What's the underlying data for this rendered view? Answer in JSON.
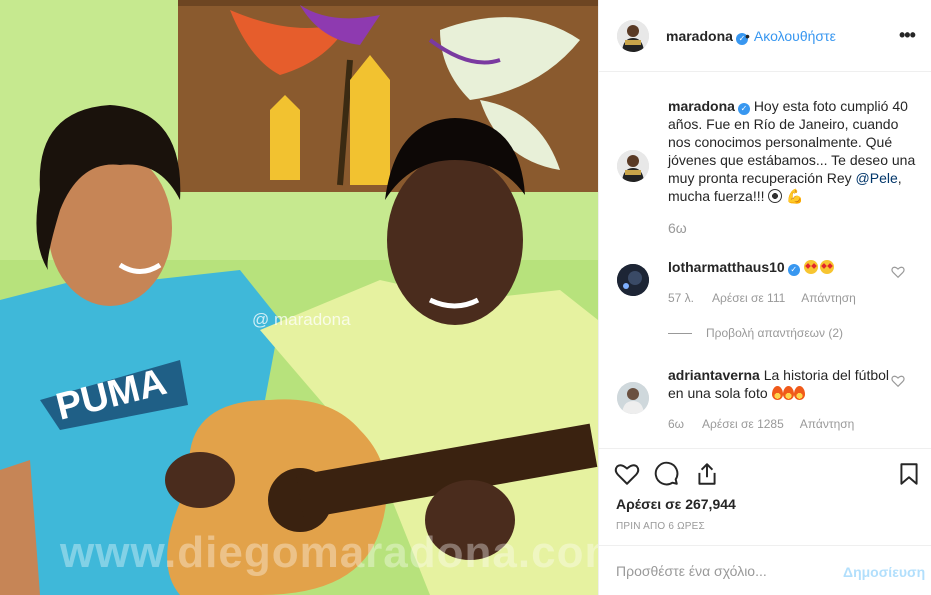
{
  "photo": {
    "watermark": "@ maradona",
    "bottom_watermark": "www.diegomaradona.com",
    "shirt_text": "PUMA"
  },
  "header": {
    "username": "maradona",
    "separator": "•",
    "follow_label": "Ακολουθήστε",
    "more_icon": "more-options-icon"
  },
  "caption": {
    "username": "maradona",
    "text_before_mention": "Hoy esta foto cumplió 40 años. Fue en Río de Janeiro, cuando nos conocimos personalmente. Qué jóvenes que estábamos... Te deseo una muy pronta recuperación Rey ",
    "mention": "@Pele",
    "text_after_mention": ", mucha fuerza!!! ",
    "time": "6ω"
  },
  "comments": [
    {
      "username": "lotharmatthaus10",
      "text": "",
      "time": "57 λ.",
      "likes": "Αρέσει σε 111",
      "reply": "Απάντηση"
    },
    {
      "username": "adriantaverna",
      "text": "La historia del fútbol en una sola foto ",
      "time": "6ω",
      "likes": "Αρέσει σε 1285",
      "reply": "Απάντηση"
    }
  ],
  "view_replies": "Προβολή απαντήσεων (2)",
  "actions": {
    "like_count": "Αρέσει σε 267,944",
    "posted_time": "ΠΡΙΝ ΑΠΟ 6 ΩΡΕΣ"
  },
  "add_comment": {
    "placeholder": "Προσθέστε ένα σχόλιο...",
    "publish_label": "Δημοσίευση"
  },
  "colors": {
    "accent": "#3897f0",
    "mention": "#003569",
    "muted": "#999999",
    "publish_disabled": "#b2dffc"
  }
}
